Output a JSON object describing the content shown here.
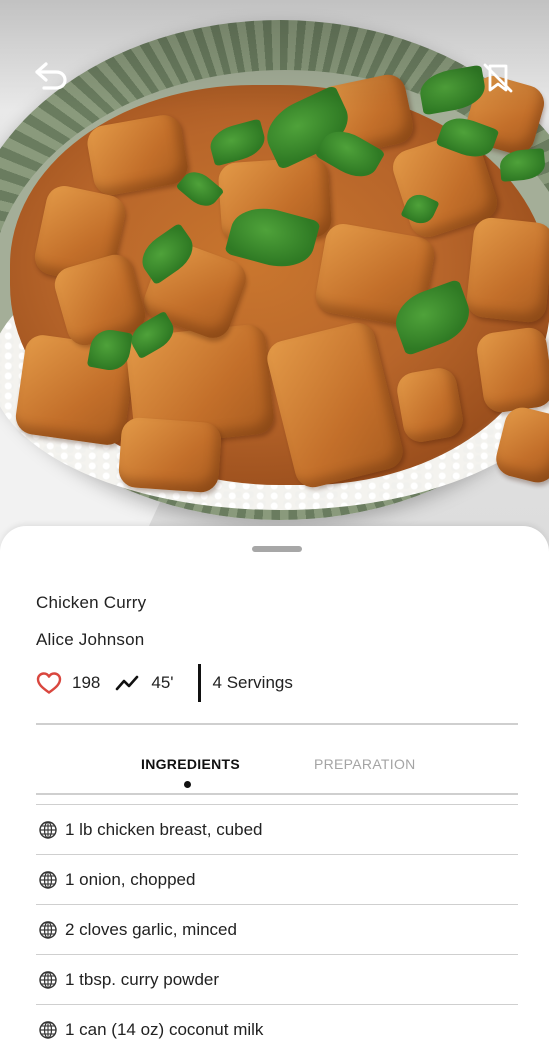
{
  "colors": {
    "heart": "#d9473f",
    "text": "#222222",
    "tab_active": "#111111",
    "tab_inactive": "#a4a4a4",
    "divider": "#cfcfcf"
  },
  "hero": {
    "image": "chicken-curry-photo",
    "back_icon": "back-arrow-icon",
    "bookmark_icon": "bookmark-off-icon"
  },
  "recipe": {
    "title": "Chicken Curry",
    "author": "Alice Johnson",
    "likes": "198",
    "time": "45'",
    "servings": "4 Servings"
  },
  "tabs": [
    {
      "label": "INGREDIENTS",
      "active": true
    },
    {
      "label": "PREPARATION",
      "active": false
    }
  ],
  "ingredients": [
    {
      "icon": "globe-icon",
      "text": "1 lb chicken breast, cubed"
    },
    {
      "icon": "globe-icon",
      "text": "1 onion, chopped"
    },
    {
      "icon": "globe-icon",
      "text": "2 cloves garlic, minced"
    },
    {
      "icon": "globe-icon",
      "text": "1 tbsp. curry powder"
    },
    {
      "icon": "globe-icon",
      "text": "1 can (14 oz) coconut milk"
    }
  ]
}
